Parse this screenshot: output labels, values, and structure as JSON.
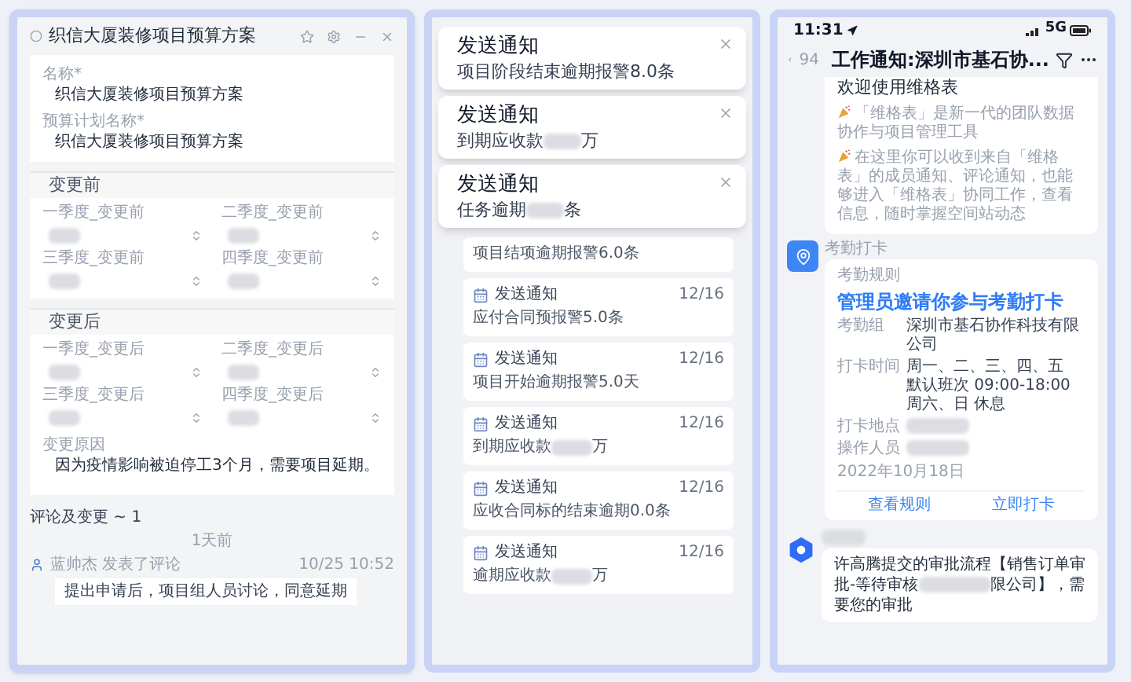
{
  "form_window": {
    "title": "织信大厦装修项目预算方案",
    "fields": [
      {
        "label": "名称*",
        "value": "织信大厦装修项目预算方案"
      },
      {
        "label": "预算计划名称*",
        "value": "织信大厦装修项目预算方案"
      }
    ],
    "sections": [
      {
        "title": "变更前",
        "fields": [
          {
            "label": "一季度_变更前"
          },
          {
            "label": "二季度_变更前"
          },
          {
            "label": "三季度_变更前"
          },
          {
            "label": "四季度_变更前"
          }
        ]
      },
      {
        "title": "变更后",
        "fields": [
          {
            "label": "一季度_变更后"
          },
          {
            "label": "二季度_变更后"
          },
          {
            "label": "三季度_变更后"
          },
          {
            "label": "四季度_变更后"
          }
        ],
        "reason": {
          "label": "变更原因",
          "value": "因为疫情影响被迫停工3个月，需要项目延期。"
        }
      }
    ],
    "comments": {
      "title": "评论及变更 ~ 1",
      "divider": "1天前",
      "items": [
        {
          "author": "蓝帅杰 发表了评论",
          "time": "10/25 10:52",
          "text": "提出申请后，项目组人员讨论，同意延期"
        }
      ]
    }
  },
  "notifications": {
    "toasts": [
      {
        "title": "发送通知",
        "text": "项目阶段结束逾期报警8.0条"
      },
      {
        "title": "发送通知",
        "text": "到期应收款",
        "suffix": "万"
      },
      {
        "title": "发送通知",
        "text": "任务逾期",
        "suffix": "条"
      }
    ],
    "cards": [
      {
        "body": "项目结项逾期报警6.0条"
      },
      {
        "title": "发送通知",
        "date": "12/16",
        "body": "应付合同预报警5.0条"
      },
      {
        "title": "发送通知",
        "date": "12/16",
        "body": "项目开始逾期报警5.0天"
      },
      {
        "title": "发送通知",
        "date": "12/16",
        "body": "到期应收款",
        "suffix": "万"
      },
      {
        "title": "发送通知",
        "date": "12/16",
        "body": "应收合同标的结束逾期0.0条"
      },
      {
        "title": "发送通知",
        "date": "12/16",
        "body": "逾期应收款",
        "suffix": "万"
      }
    ]
  },
  "phone": {
    "status": {
      "time": "11:31",
      "network": "5G"
    },
    "header": {
      "back_count": "94",
      "title": "工作通知:深圳市基石协..."
    },
    "messages": [
      {
        "kind": "welcome",
        "title": "欢迎使用维格表",
        "paragraphs": [
          "「维格表」是新一代的团队数据协作与项目管理工具",
          "在这里你可以收到来自「维格表」的成员通知、评论通知，也能够进入「维格表」协同工作，查看信息，随时掌握空间站动态"
        ]
      },
      {
        "kind": "attendance",
        "sender": "考勤打卡",
        "heading": "考勤规则",
        "headline": "管理员邀请你参与考勤打卡",
        "rows": [
          {
            "label": "考勤组",
            "lines": [
              "深圳市基石协作科技有限公司"
            ],
            "redacted": false
          },
          {
            "label": "打卡时间",
            "lines": [
              "周一、二、三、四、五",
              "默认班次 09:00-18:00",
              "周六、日 休息"
            ],
            "redacted": false
          },
          {
            "label": "打卡地点",
            "redacted": true
          },
          {
            "label": "操作人员",
            "redacted": true
          }
        ],
        "date": "2022年10月18日",
        "actions": [
          "查看规则",
          "立即打卡"
        ]
      },
      {
        "kind": "approval",
        "text_before": "许高腾提交的审批流程【销售订单审批-等待审核",
        "text_after": "限公司】，需要您的审批"
      }
    ]
  }
}
